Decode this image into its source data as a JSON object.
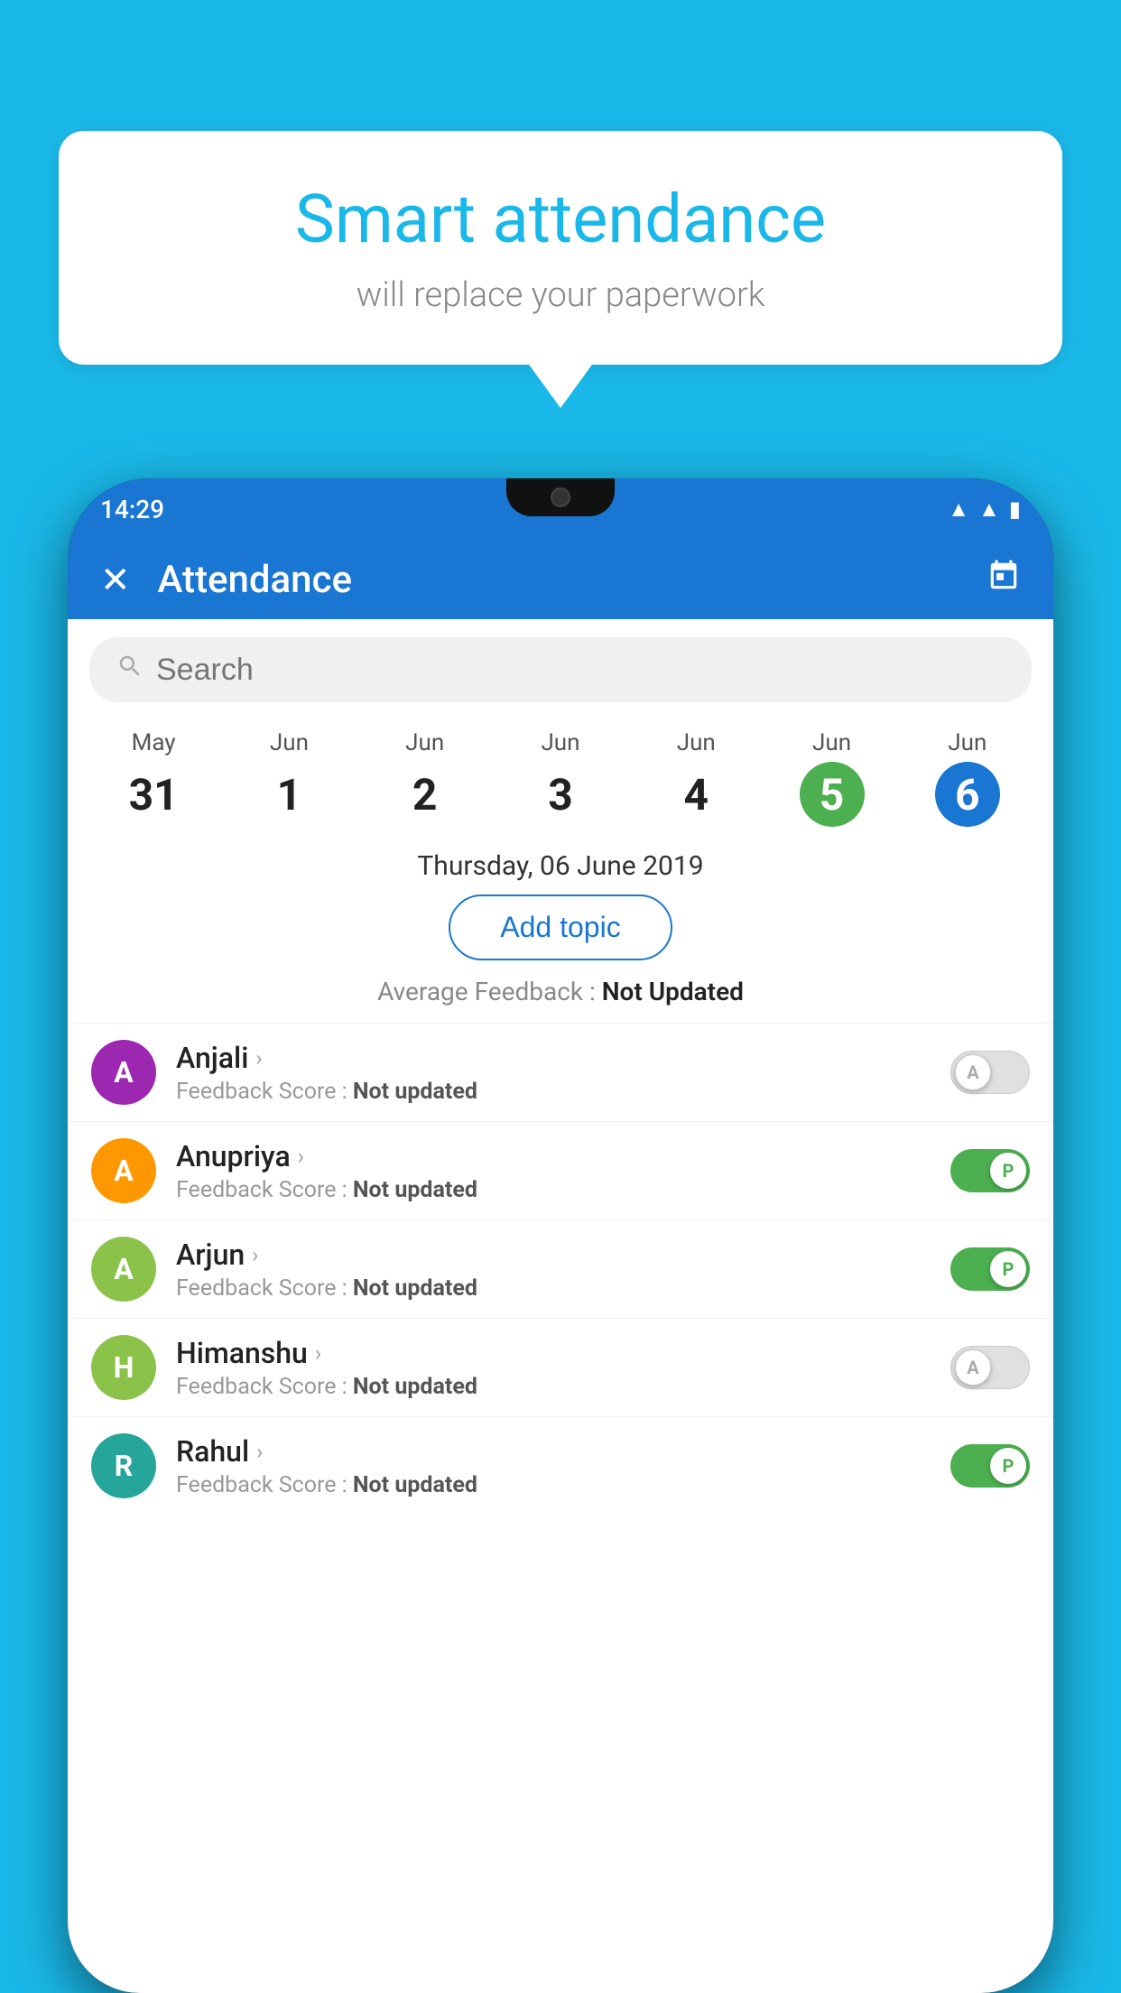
{
  "background": {
    "color": "#1ab8e8"
  },
  "speech_bubble": {
    "title": "Smart attendance",
    "subtitle": "will replace your paperwork"
  },
  "status_bar": {
    "time": "14:29",
    "icons": [
      "wifi",
      "signal",
      "battery"
    ]
  },
  "app_bar": {
    "title": "Attendance",
    "close_label": "✕",
    "calendar_icon": "📅"
  },
  "search": {
    "placeholder": "Search"
  },
  "calendar": {
    "days": [
      {
        "month": "May",
        "date": "31",
        "state": "normal"
      },
      {
        "month": "Jun",
        "date": "1",
        "state": "normal"
      },
      {
        "month": "Jun",
        "date": "2",
        "state": "normal"
      },
      {
        "month": "Jun",
        "date": "3",
        "state": "normal"
      },
      {
        "month": "Jun",
        "date": "4",
        "state": "normal"
      },
      {
        "month": "Jun",
        "date": "5",
        "state": "today"
      },
      {
        "month": "Jun",
        "date": "6",
        "state": "selected"
      }
    ]
  },
  "selected_date_label": "Thursday, 06 June 2019",
  "add_topic_button": "Add topic",
  "average_feedback": {
    "label": "Average Feedback : ",
    "value": "Not Updated"
  },
  "students": [
    {
      "name": "Anjali",
      "initial": "A",
      "avatar_color": "purple",
      "feedback_label": "Feedback Score : ",
      "feedback_value": "Not updated",
      "toggle_state": "off",
      "toggle_label": "A"
    },
    {
      "name": "Anupriya",
      "initial": "A",
      "avatar_color": "orange",
      "feedback_label": "Feedback Score : ",
      "feedback_value": "Not updated",
      "toggle_state": "on",
      "toggle_label": "P"
    },
    {
      "name": "Arjun",
      "initial": "A",
      "avatar_color": "green",
      "feedback_label": "Feedback Score : ",
      "feedback_value": "Not updated",
      "toggle_state": "on",
      "toggle_label": "P"
    },
    {
      "name": "Himanshu",
      "initial": "H",
      "avatar_color": "lime",
      "feedback_label": "Feedback Score : ",
      "feedback_value": "Not updated",
      "toggle_state": "off",
      "toggle_label": "A"
    },
    {
      "name": "Rahul",
      "initial": "R",
      "avatar_color": "teal",
      "feedback_label": "Feedback Score : ",
      "feedback_value": "Not updated",
      "toggle_state": "on",
      "toggle_label": "P"
    }
  ]
}
